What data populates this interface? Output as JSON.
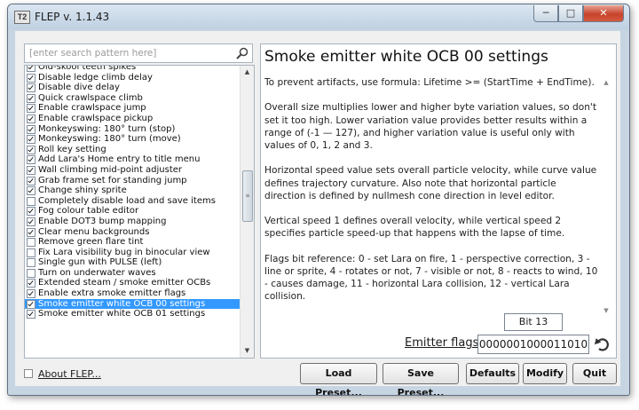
{
  "window": {
    "title": "FLEP v. 1.1.43",
    "app_icon_text": "T2"
  },
  "search": {
    "placeholder": "[enter search pattern here]"
  },
  "patches": [
    {
      "label": "Old-skool teeth spikes",
      "checked": true
    },
    {
      "label": "Disable ledge climb delay",
      "checked": true
    },
    {
      "label": "Disable dive delay",
      "checked": true
    },
    {
      "label": "Quick crawlspace climb",
      "checked": true
    },
    {
      "label": "Enable crawlspace jump",
      "checked": true
    },
    {
      "label": "Enable crawlspace pickup",
      "checked": true
    },
    {
      "label": "Monkeyswing: 180° turn (stop)",
      "checked": true
    },
    {
      "label": "Monkeyswing: 180° turn (move)",
      "checked": true
    },
    {
      "label": "Roll key setting",
      "checked": true
    },
    {
      "label": "Add Lara's Home entry to title menu",
      "checked": true
    },
    {
      "label": "Wall climbing mid-point adjuster",
      "checked": true
    },
    {
      "label": "Grab frame set for standing jump",
      "checked": true
    },
    {
      "label": "Change shiny sprite",
      "checked": true
    },
    {
      "label": "Completely disable load and save items",
      "checked": false
    },
    {
      "label": "Fog colour table editor",
      "checked": true
    },
    {
      "label": "Enable DOT3 bump mapping",
      "checked": true
    },
    {
      "label": "Clear menu backgrounds",
      "checked": true
    },
    {
      "label": "Remove green flare tint",
      "checked": false
    },
    {
      "label": "Fix Lara visibility bug in binocular view",
      "checked": false
    },
    {
      "label": "Single gun with PULSE (left)",
      "checked": false
    },
    {
      "label": "Turn on underwater waves",
      "checked": false
    },
    {
      "label": "Extended steam / smoke emitter OCBs",
      "checked": true
    },
    {
      "label": "Enable extra smoke emitter flags",
      "checked": true
    },
    {
      "label": "Smoke emitter white OCB 00 settings",
      "checked": true,
      "selected": true
    },
    {
      "label": "Smoke emitter white OCB 01 settings",
      "checked": true
    }
  ],
  "description": {
    "title": "Smoke emitter white OCB 00 settings",
    "paragraphs": [
      "To prevent artifacts, use formula: Lifetime >= (StartTime + EndTime).",
      "Overall size multiplies lower and higher byte variation values, so don't set it too high. Lower variation value provides better results within a range of (-1 — 127), and higher variation value is useful only with values of 0, 1, 2 and 3.",
      "Horizontal speed value sets overall particle velocity, while curve value defines trajectory curvature. Also note that horizontal particle direction is defined by nullmesh cone direction in level editor.",
      "Vertical speed 1 defines overall velocity, while vertical speed 2 specifies particle speed-up that happens with the lapse of time.",
      "Flags bit reference: 0 - set Lara on fire, 1 - perspective correction, 3 - line or sprite, 4 - rotates or not, 7 - visible or not, 8 - reacts to wind, 10 - causes damage, 11 - horizontal Lara collision, 12 - vertical Lara collision."
    ]
  },
  "bit_indicator": "Bit 13",
  "emitter_flags": {
    "label": "Emitter flags:",
    "value": "0000001000011010"
  },
  "about_link": "About FLEP...",
  "buttons": {
    "load_preset": "Load Preset...",
    "save_preset": "Save Preset...",
    "defaults": "Defaults",
    "modify": "Modify",
    "quit": "Quit"
  },
  "colors": {
    "selection": "#3399ff",
    "close_button": "#c7432b"
  }
}
